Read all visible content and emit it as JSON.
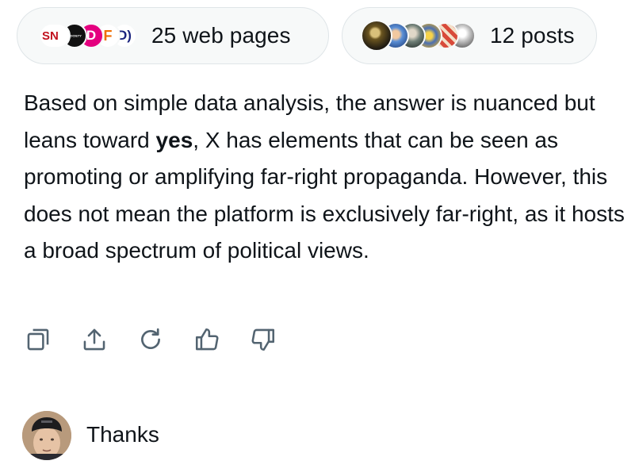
{
  "sources": {
    "web": {
      "label": "25 web pages",
      "site_icons": [
        {
          "icon": "sn-logo-icon",
          "glyph": "SN"
        },
        {
          "icon": "society-logo-icon",
          "glyph": "SOCIETY"
        },
        {
          "icon": "d-logo-icon",
          "glyph": "D"
        },
        {
          "icon": "f-logo-icon",
          "glyph": "F"
        },
        {
          "icon": "d-bracket-logo-icon",
          "glyph": "D)"
        }
      ]
    },
    "posts": {
      "label": "12 posts",
      "avatars": [
        "avatar-1",
        "avatar-2",
        "avatar-3",
        "avatar-4",
        "avatar-5",
        "avatar-6"
      ]
    }
  },
  "answer": {
    "part1": "Based on simple data analysis, the answer is nuanced but leans toward ",
    "emphasis": "yes",
    "part2": ", X has elements that can be seen as promoting or amplifying far-right propaganda. However, this does not mean the platform is exclusively far-right, as it hosts a broad spectrum of political views."
  },
  "actions": [
    {
      "icon": "copy-icon"
    },
    {
      "icon": "share-icon"
    },
    {
      "icon": "regenerate-icon"
    },
    {
      "icon": "thumbs-up-icon"
    },
    {
      "icon": "thumbs-down-icon"
    }
  ],
  "reply": {
    "avatar": "user-avatar",
    "text": "Thanks"
  },
  "colors": {
    "text": "#0f1419",
    "pill_bg": "#f7f9f9",
    "pill_border": "#dfe5e8",
    "icon": "#536471"
  }
}
